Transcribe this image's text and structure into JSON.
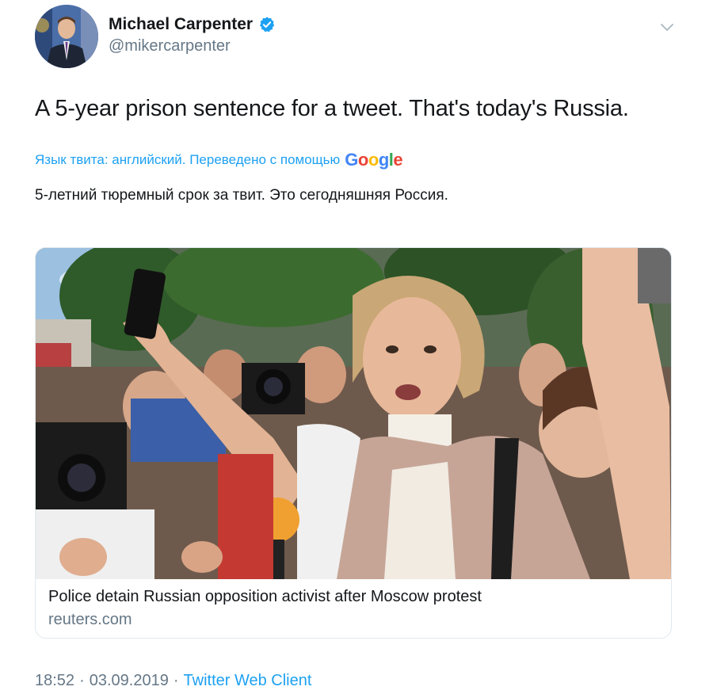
{
  "author": {
    "name": "Michael Carpenter",
    "handle": "@mikercarpenter",
    "verified": true
  },
  "tweet": {
    "text": "A 5-year prison sentence for a tweet. That's today's Russia.",
    "translation_label": "Язык твита: английский. Переведено с помощью",
    "translation_provider": "Google",
    "translated_text": "5-летний тюремный срок за твит. Это сегодняшняя Россия."
  },
  "link_card": {
    "title": "Police detain Russian opposition activist after Moscow protest",
    "domain": "reuters.com"
  },
  "meta": {
    "time": "18:52",
    "separator1": "·",
    "date": "03.09.2019",
    "separator2": "·",
    "source": "Twitter Web Client"
  },
  "icons": {
    "verified": "verified-badge-icon",
    "chevron": "chevron-down-icon"
  },
  "colors": {
    "accent": "#1da1f2",
    "text": "#14171a",
    "secondary": "#657786",
    "border": "#e1e8ed"
  }
}
